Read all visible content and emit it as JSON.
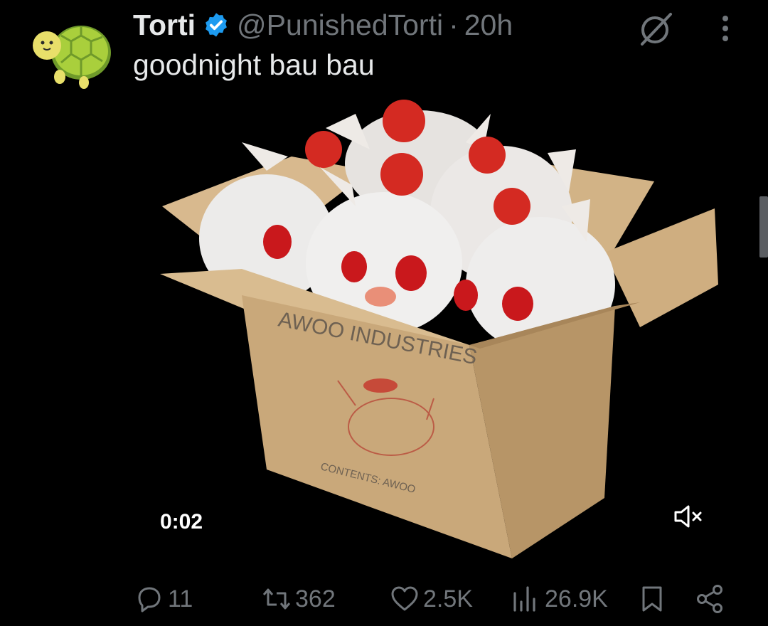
{
  "tweet": {
    "author_name": "Torti",
    "handle": "@PunishedTorti",
    "separator": "·",
    "time": "20h",
    "text": "goodnight bau bau",
    "verified_color": "#1d9bf0"
  },
  "media": {
    "timestamp": "0:02",
    "box_text": "AWOO INDUSTRIES",
    "box_contents": "CONTENTS:   AWOO",
    "muted": true
  },
  "actions": {
    "replies": "11",
    "reposts": "362",
    "likes": "2.5K",
    "views": "26.9K"
  },
  "icons": [
    "verified-badge-icon",
    "grok-icon",
    "more-icon",
    "mute-icon",
    "reply-icon",
    "repost-icon",
    "like-icon",
    "views-icon",
    "bookmark-icon",
    "share-icon"
  ],
  "colors": {
    "background": "#000000",
    "text": "#e7e9ea",
    "secondary": "#71767b",
    "accent": "#1d9bf0"
  }
}
